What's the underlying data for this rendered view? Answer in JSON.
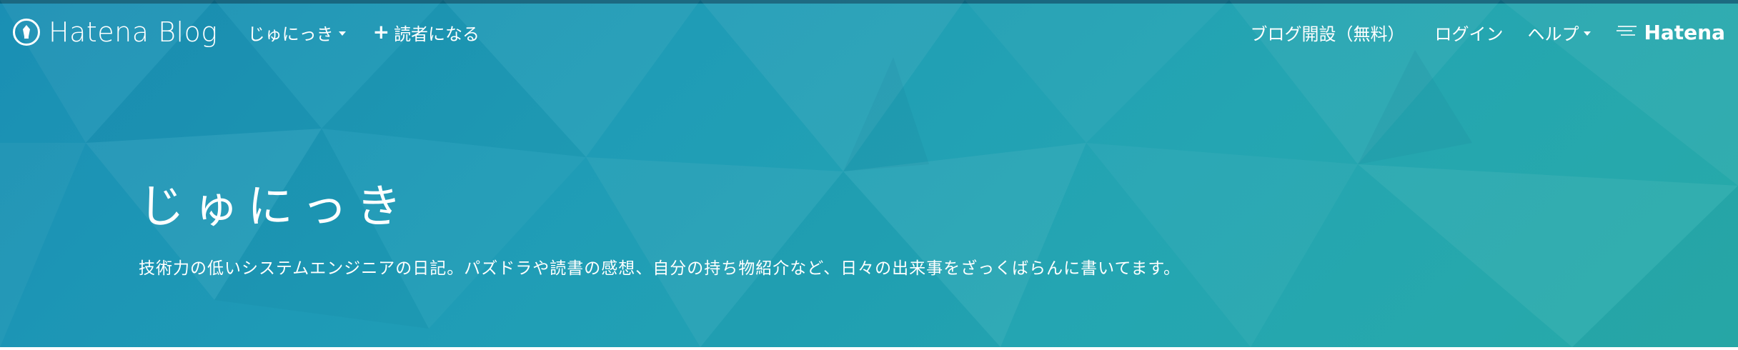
{
  "navbar": {
    "brand_label": "Hatena Blog",
    "blog_menu_label": "じゅにっき",
    "subscribe_label": "読者になる",
    "start_blog_label": "ブログ開設（無料）",
    "login_label": "ログイン",
    "help_label": "ヘルプ",
    "hatena_label": "Hatena"
  },
  "hero": {
    "title": "じゅにっき",
    "description": "技術力の低いシステムエンジニアの日記。パズドラや読書の感想、自分の持ち物紹介など、日々の出来事をざっくばらんに書いてます。"
  },
  "colors": {
    "header_gradient_start": "#1a8fb4",
    "header_gradient_end": "#27aaa8",
    "text": "#ffffff"
  },
  "icons": {
    "brand": "hatena-blog-pen-icon",
    "dropdown": "caret-down-icon",
    "subscribe": "plus-icon",
    "hatena": "hatena-logo-icon"
  }
}
